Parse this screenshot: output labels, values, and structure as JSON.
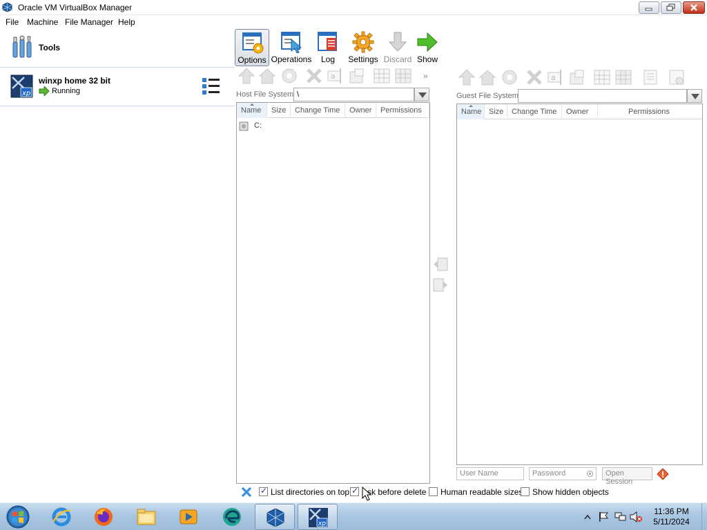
{
  "window": {
    "title": "Oracle VM VirtualBox Manager"
  },
  "menubar": {
    "items": [
      "File",
      "Machine",
      "File Manager",
      "Help"
    ]
  },
  "left_pane": {
    "tools_label": "Tools",
    "vm": {
      "name": "winxp home 32 bit",
      "state": "Running"
    }
  },
  "toolbar": {
    "buttons": [
      {
        "label": "Options",
        "icon": "options-icon",
        "state": "active"
      },
      {
        "label": "Operations",
        "icon": "operations-icon",
        "state": "enabled"
      },
      {
        "label": "Log",
        "icon": "log-icon",
        "state": "enabled"
      },
      {
        "label": "Settings",
        "icon": "settings-gear-icon",
        "state": "enabled"
      },
      {
        "label": "Discard",
        "icon": "discard-arrow-icon",
        "state": "disabled"
      },
      {
        "label": "Show",
        "icon": "show-arrow-icon",
        "state": "enabled"
      }
    ]
  },
  "host_panel": {
    "fs_label": "Host File System:",
    "path": "\\",
    "columns": [
      "Name",
      "Size",
      "Change Time",
      "Owner",
      "Permissions"
    ],
    "rows": [
      {
        "name": "C:"
      }
    ],
    "more_glyph": "»"
  },
  "guest_panel": {
    "fs_label": "Guest File System:",
    "path": "",
    "columns": [
      "Name",
      "Size",
      "Change Time",
      "Owner",
      "Permissions"
    ],
    "rows": [],
    "session": {
      "user_placeholder": "User Name",
      "password_placeholder": "Password",
      "open_label": "Open Session"
    }
  },
  "options": {
    "list_directories_on_top": {
      "label": "List directories on top",
      "checked": true
    },
    "ask_before_delete": {
      "label": "Ask before delete",
      "checked": true
    },
    "human_readable_sizes": {
      "label": "Human readable sizes",
      "checked": false
    },
    "show_hidden_objects": {
      "label": "Show hidden objects",
      "checked": false
    }
  },
  "taskbar": {
    "apps": [
      "internet-explorer-icon",
      "firefox-icon",
      "file-explorer-icon",
      "media-player-icon",
      "edge-icon",
      "virtualbox-icon",
      "winxp-vm-icon"
    ],
    "clock": {
      "time": "11:36 PM",
      "date": "5/11/2024"
    }
  },
  "colors": {
    "selection_border": "#c9d9ea",
    "taskbar": "#a9c6e2",
    "close_button": "#c1301b"
  }
}
